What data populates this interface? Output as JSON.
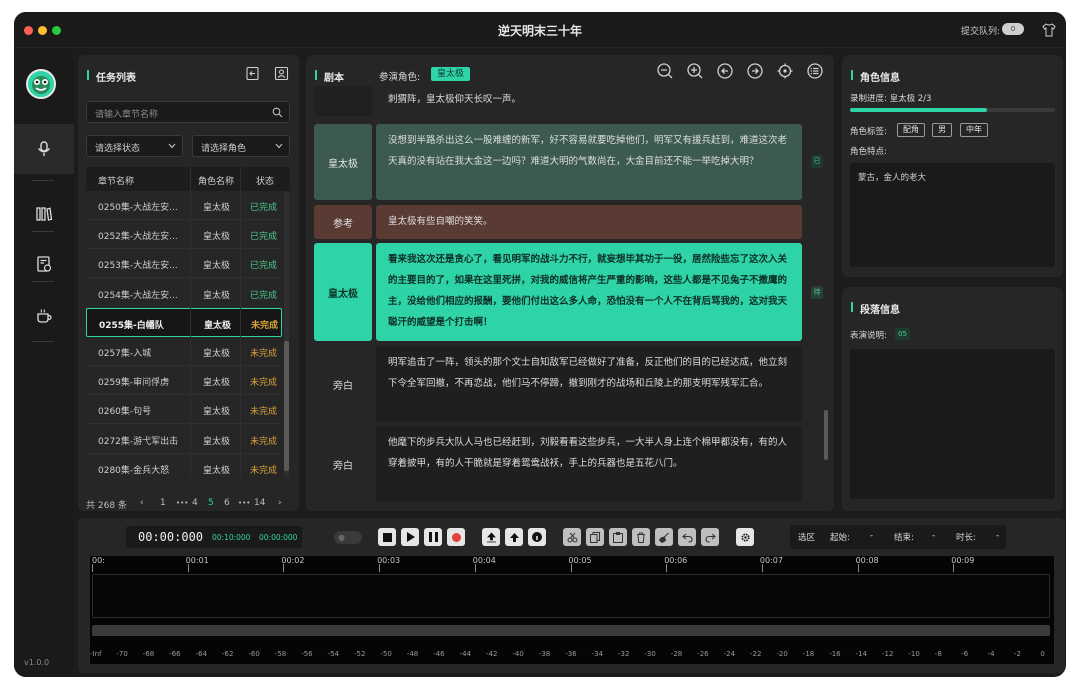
{
  "window": {
    "title": "逆天明末三十年",
    "queue_label": "提交队列:",
    "queue_toggle": "0"
  },
  "nav": {
    "version": "v1.0.0",
    "items": [
      "mic-icon",
      "books-icon",
      "invoice-icon",
      "coffee-icon"
    ]
  },
  "task_list": {
    "title": "任务列表",
    "search_placeholder": "请输入章节名称",
    "status_filter": "请选择状态",
    "role_filter": "请选择角色",
    "headers": {
      "chapter": "章节名称",
      "role": "角色名称",
      "status": "状态"
    },
    "rows": [
      {
        "chapter": "0250集-大战左安...",
        "role": "皇太极",
        "status": "已完成",
        "done": true
      },
      {
        "chapter": "0252集-大战左安...",
        "role": "皇太极",
        "status": "已完成",
        "done": true
      },
      {
        "chapter": "0253集-大战左安...",
        "role": "皇太极",
        "status": "已完成",
        "done": true
      },
      {
        "chapter": "0254集-大战左安...",
        "role": "皇太极",
        "status": "已完成",
        "done": true
      },
      {
        "chapter": "0255集-白幡队",
        "role": "皇太极",
        "status": "未完成",
        "done": false,
        "selected": true
      },
      {
        "chapter": "0257集-入城",
        "role": "皇太极",
        "status": "未完成",
        "done": false
      },
      {
        "chapter": "0259集-审问俘虏",
        "role": "皇太极",
        "status": "未完成",
        "done": false
      },
      {
        "chapter": "0260集-句号",
        "role": "皇太极",
        "status": "未完成",
        "done": false
      },
      {
        "chapter": "0272集-游弋军出击",
        "role": "皇太极",
        "status": "未完成",
        "done": false
      },
      {
        "chapter": "0280集-金兵大怒",
        "role": "皇太极",
        "status": "未完成",
        "done": false
      }
    ],
    "pager": {
      "total": "共 268 条",
      "prev": "‹",
      "p1": "1",
      "ellipsis1": "•••",
      "p4": "4",
      "p5": "5",
      "p6": "6",
      "ellipsis2": "•••",
      "p14": "14",
      "next": "›"
    }
  },
  "script": {
    "title": "剧本",
    "cast_label": "参演角色:",
    "cast_role": "皇太极",
    "lines": [
      {
        "role": "",
        "text": "刺猬阵，皇太极仰天长叹一声。",
        "kind": "plain"
      },
      {
        "role": "皇太极",
        "text": "没想到半路杀出这么一股难缠的新军，好不容易就要吃掉他们，明军又有援兵赶到，难道这次老天真的没有站在我大金这一边吗？难道大明的气数尚在，大金目前还不能一举吃掉大明？",
        "kind": "recorded",
        "mark": "已"
      },
      {
        "role": "参考",
        "text": "皇太极有些自嘲的笑笑。",
        "kind": "ref"
      },
      {
        "role": "皇太极",
        "text": "看来我这次还是贪心了，看见明军的战斗力不行，就妄想毕其功于一役，居然险些忘了这次入关的主要目的了，如果在这里死拼，对我的威信将产生严重的影响，这些人都是不见兔子不撒鹰的主，没给他们相应的报酬，要他们付出这么多人命，恐怕没有一个人不在背后骂我的，这对我天聪汗的威望是个打击啊！",
        "kind": "active",
        "mark": "待"
      },
      {
        "role": "旁白",
        "text": "明军追击了一阵，领头的那个文士自知敌军已经做好了准备，反正他们的目的已经达成，他立刻下令全军回撤，不再恋战，他们马不停蹄，撤到刚才的战场和丘陵上的那支明军残军汇合。",
        "kind": "plain"
      },
      {
        "role": "旁白",
        "text": "他麾下的步兵大队人马也已经赶到，刘毅看看这些步兵，一大半人身上连个棉甲都没有，有的人穿着披甲，有的人干脆就是穿着鸳鸯战袄，手上的兵器也是五花八门。",
        "kind": "plain"
      }
    ]
  },
  "role_info": {
    "title": "角色信息",
    "progress_label": "录制进度: 皇太极 2/3",
    "progress": 0.67,
    "tags_label": "角色标签:",
    "tags": [
      "配角",
      "男",
      "中年"
    ],
    "traits_label": "角色特点:",
    "traits": "蒙古，金人的老大"
  },
  "para_info": {
    "title": "段落信息",
    "desc_label": "表演说明:",
    "desc_badge": "05"
  },
  "audio": {
    "time_main": "00:00:000",
    "time_a": "00:10:000",
    "time_b": "00:00:000",
    "mode_toggle": "●",
    "range_label": "选区",
    "start_label": "起始:",
    "start_val": "-",
    "end_label": "结束:",
    "end_val": "-",
    "dur_label": "时长:",
    "dur_val": "-",
    "ticks": [
      "00:",
      "00:01",
      "00:02",
      "00:03",
      "00:04",
      "00:05",
      "00:06",
      "00:07",
      "00:08",
      "00:09"
    ],
    "db": [
      "-Inf",
      "-70",
      "-68",
      "-66",
      "-64",
      "-62",
      "-60",
      "-58",
      "-56",
      "-54",
      "-52",
      "-50",
      "-48",
      "-46",
      "-44",
      "-42",
      "-40",
      "-38",
      "-36",
      "-34",
      "-32",
      "-30",
      "-28",
      "-26",
      "-24",
      "-22",
      "-20",
      "-18",
      "-16",
      "-14",
      "-12",
      "-10",
      "-8",
      "-6",
      "-4",
      "-2",
      "0"
    ]
  },
  "colors": {
    "accent": "#2fd3a8",
    "done": "#4ec98e",
    "todo": "#d9a23b",
    "recorded": "#3c5a52",
    "ref": "#5a3b34"
  }
}
